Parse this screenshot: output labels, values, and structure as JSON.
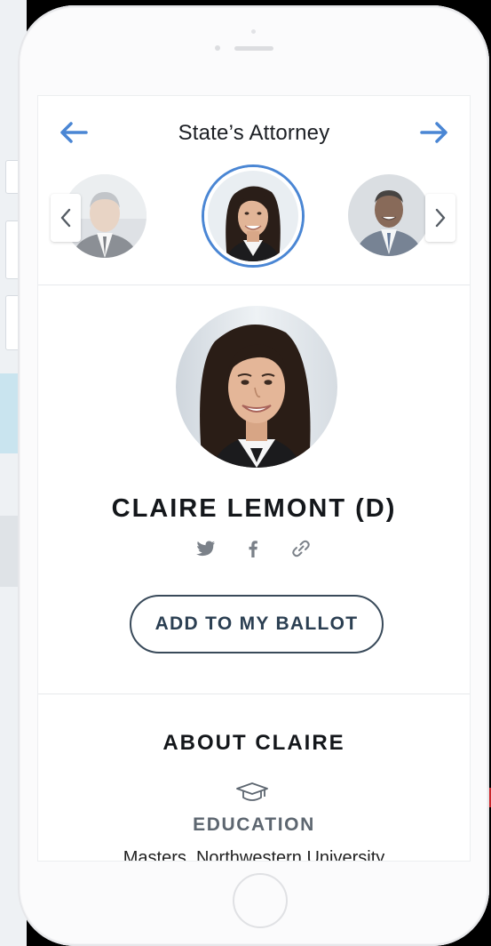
{
  "header": {
    "office_title": "State’s Attorney"
  },
  "candidate": {
    "name": "CLAIRE LEMONT (D)",
    "add_button_label": "ADD TO MY BALLOT"
  },
  "social_icons": [
    "twitter-icon",
    "facebook-icon",
    "link-icon"
  ],
  "about": {
    "title": "ABOUT CLAIRE",
    "education_label": "EDUCATION",
    "education_value": "Masters, Northwestern University"
  },
  "colors": {
    "accent": "#4a86d4",
    "button_border": "#394a5a",
    "text_dark": "#14171b",
    "muted": "#5d6670"
  }
}
